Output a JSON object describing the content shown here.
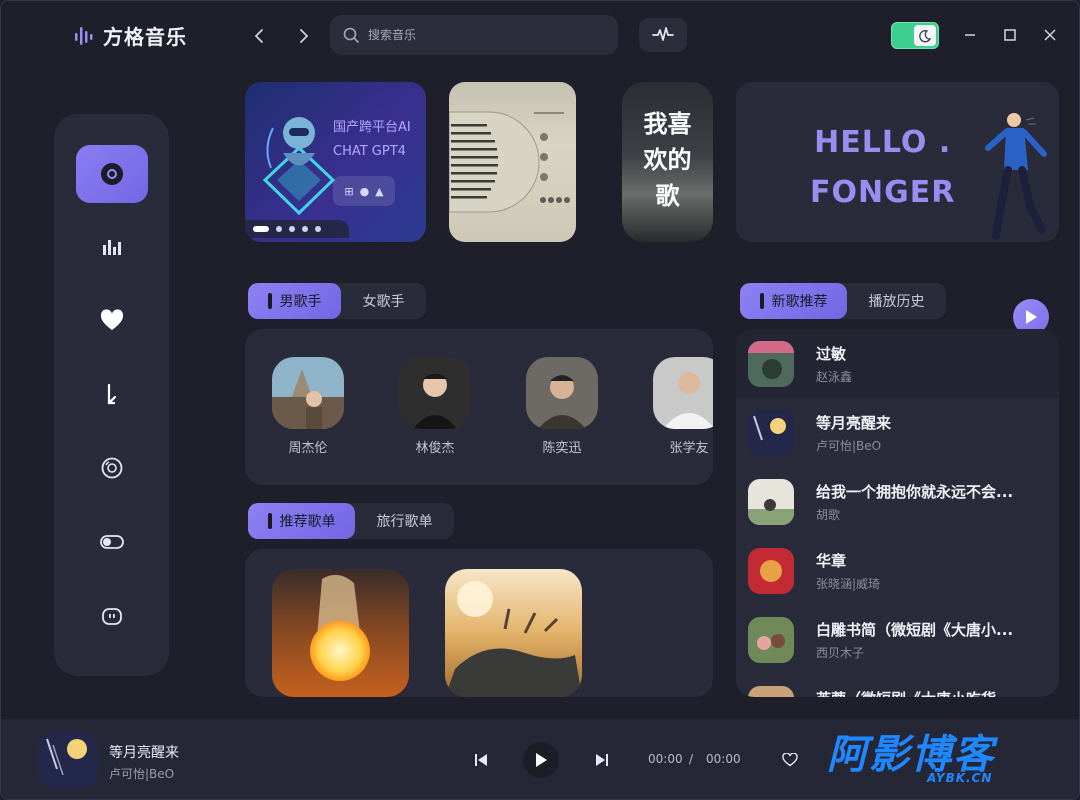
{
  "app": {
    "title": "方格音乐"
  },
  "search": {
    "placeholder": "搜索音乐"
  },
  "banners": {
    "ai_line1": "国产跨平台AI",
    "ai_line2": "CHAT GPT4",
    "fav_text_1": "我喜",
    "fav_text_2": "欢的",
    "fav_text_3": "歌",
    "hello_line1": "HELLO .",
    "hello_line2": "FONGER"
  },
  "singer_tabs": [
    "男歌手",
    "女歌手"
  ],
  "singers": [
    {
      "name": "周杰伦"
    },
    {
      "name": "林俊杰"
    },
    {
      "name": "陈奕迅"
    },
    {
      "name": "张学友"
    }
  ],
  "playlist_tabs": [
    "推荐歌单",
    "旅行歌单"
  ],
  "song_tabs": [
    "新歌推荐",
    "播放历史"
  ],
  "songs": [
    {
      "title": "过敏",
      "artist": "赵泳鑫"
    },
    {
      "title": "等月亮醒来",
      "artist": "卢可怡|BeO"
    },
    {
      "title": "给我一个拥抱你就永远不会...",
      "artist": "胡歌"
    },
    {
      "title": "华章",
      "artist": "张晓涵|威琦"
    },
    {
      "title": "白雕书简（微短剧《大唐小...",
      "artist": "西贝木子"
    },
    {
      "title": "芙蓉（微短剧《大唐小吃货...",
      "artist": ""
    }
  ],
  "now_playing": {
    "title": "等月亮醒来",
    "artist": "卢可怡|BeO",
    "current_time": "00:00",
    "separator": "/",
    "total_time": "00:00"
  },
  "watermark": {
    "main": "阿影博客",
    "sub": "AYBK.CN"
  },
  "colors": {
    "accent": "#8b7cf2",
    "background": "#1e1f2b",
    "panel": "#2a2b3a",
    "toggle": "#3ecf8e"
  }
}
